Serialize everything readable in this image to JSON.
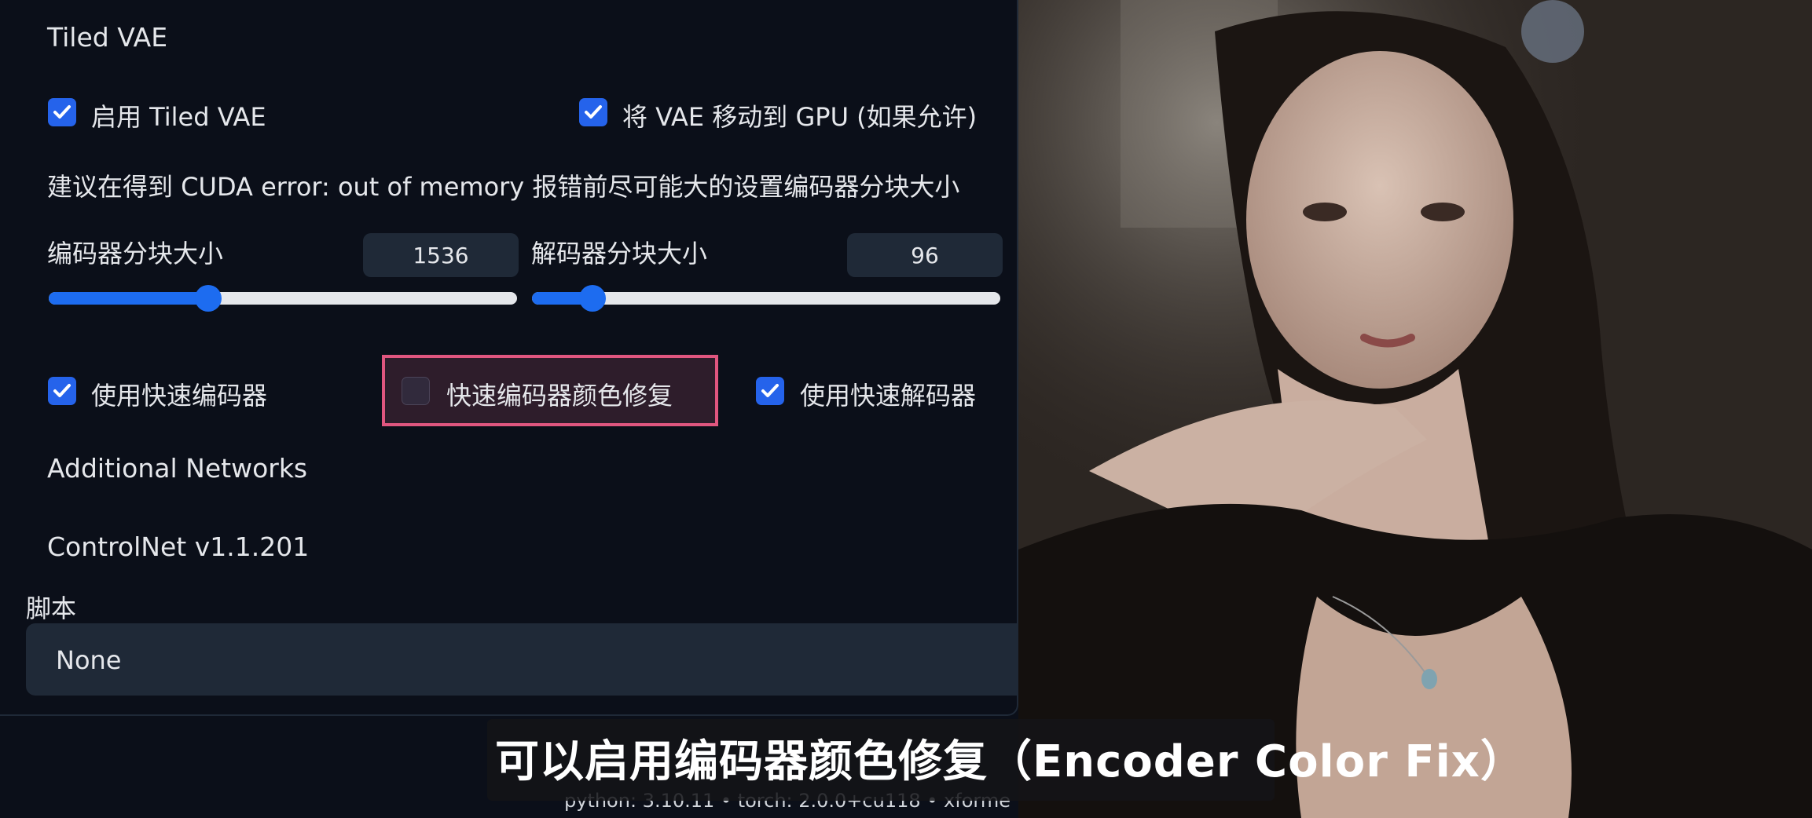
{
  "tiled_vae": {
    "title": "Tiled VAE",
    "enable_label": "启用 Tiled VAE",
    "enable_checked": true,
    "move_vae_label": "将 VAE 移动到 GPU (如果允许)",
    "move_vae_checked": true,
    "hint": "建议在得到 CUDA error: out of memory 报错前尽可能大的设置编码器分块大小",
    "encoder_tile_label": "编码器分块大小",
    "encoder_tile_value": "1536",
    "encoder_tile_fraction": 0.34,
    "decoder_tile_label": "解码器分块大小",
    "decoder_tile_value": "96",
    "decoder_tile_fraction": 0.13,
    "fast_encoder_label": "使用快速编码器",
    "fast_encoder_checked": true,
    "color_fix_label": "快速编码器颜色修复",
    "color_fix_checked": false,
    "fast_decoder_label": "使用快速解码器",
    "fast_decoder_checked": true
  },
  "sections": {
    "additional_networks": "Additional Networks",
    "controlnet": "ControlNet v1.1.201"
  },
  "script": {
    "label": "脚本",
    "value": "None"
  },
  "footer": {
    "text": "python: 3.10.11  •  torch: 2.0.0+cu118  •  xforme"
  },
  "subtitle": "可以启用编码器颜色修复（Encoder Color Fix）",
  "colors": {
    "accent": "#2563eb",
    "highlight_border": "#e0567f",
    "panel_bg": "#0b0f19"
  }
}
